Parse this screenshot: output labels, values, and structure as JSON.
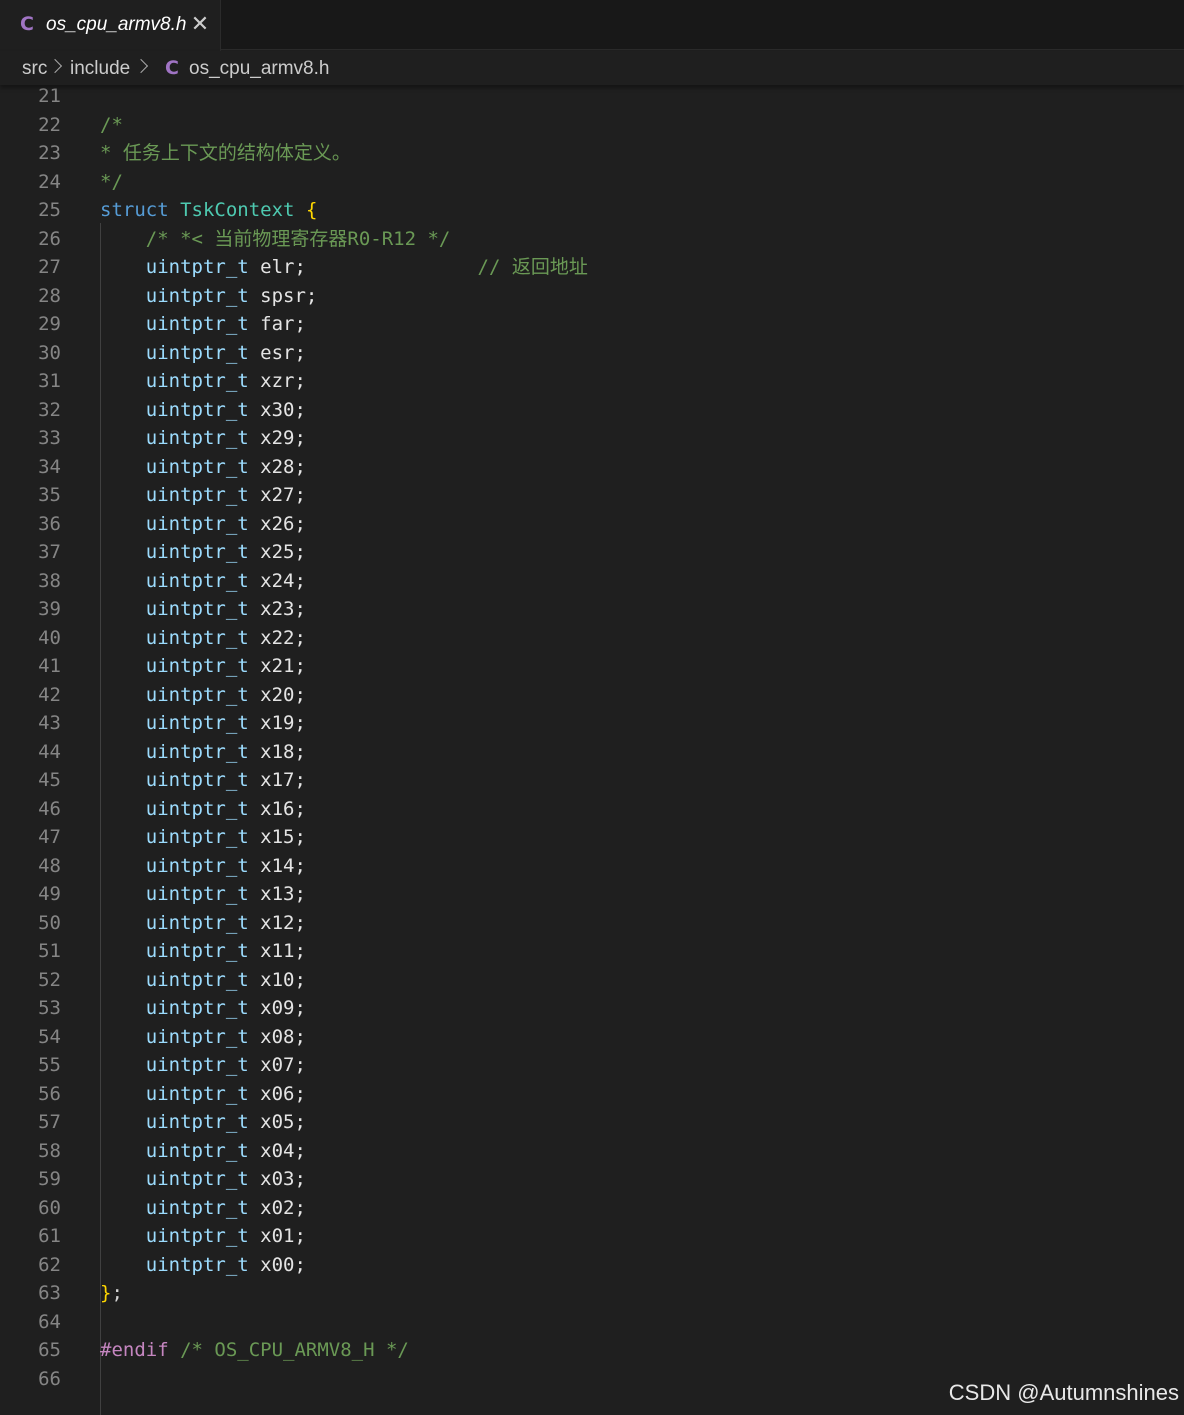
{
  "tab": {
    "file_name": "os_cpu_armv8.h",
    "close_symbol": "✕",
    "language_symbol": "C"
  },
  "breadcrumb": {
    "items": [
      "src",
      "include",
      "os_cpu_armv8.h"
    ]
  },
  "colors": {
    "background": "#1f1f1f",
    "comment": "#6a9955",
    "keyword": "#569cd6",
    "type": "#4ec9b0",
    "field_type": "#9cdcfe",
    "brace": "#ffd700",
    "preprocessor": "#c586c0"
  },
  "code_lines": [
    {
      "n": "21",
      "tokens": []
    },
    {
      "n": "22",
      "tokens": [
        [
          "com",
          "/*"
        ]
      ]
    },
    {
      "n": "23",
      "tokens": [
        [
          "com",
          "* 任务上下文的结构体定义。"
        ]
      ]
    },
    {
      "n": "24",
      "tokens": [
        [
          "com",
          "*/"
        ]
      ]
    },
    {
      "n": "25",
      "tokens": [
        [
          "kw",
          "struct"
        ],
        [
          "plain",
          " "
        ],
        [
          "type",
          "TskContext"
        ],
        [
          "plain",
          " "
        ],
        [
          "brace",
          "{"
        ]
      ]
    },
    {
      "n": "26",
      "tokens": [
        [
          "plain",
          "    "
        ],
        [
          "com",
          "/* *< 当前物理寄存器R0-R12 */"
        ]
      ]
    },
    {
      "n": "27",
      "tokens": [
        [
          "plain",
          "    "
        ],
        [
          "var",
          "uintptr_t"
        ],
        [
          "fld",
          " elr;"
        ],
        [
          "plain",
          "               "
        ],
        [
          "com",
          "// 返回地址"
        ]
      ]
    },
    {
      "n": "28",
      "tokens": [
        [
          "plain",
          "    "
        ],
        [
          "var",
          "uintptr_t"
        ],
        [
          "fld",
          " spsr;"
        ]
      ]
    },
    {
      "n": "29",
      "tokens": [
        [
          "plain",
          "    "
        ],
        [
          "var",
          "uintptr_t"
        ],
        [
          "fld",
          " far;"
        ]
      ]
    },
    {
      "n": "30",
      "tokens": [
        [
          "plain",
          "    "
        ],
        [
          "var",
          "uintptr_t"
        ],
        [
          "fld",
          " esr;"
        ]
      ]
    },
    {
      "n": "31",
      "tokens": [
        [
          "plain",
          "    "
        ],
        [
          "var",
          "uintptr_t"
        ],
        [
          "fld",
          " xzr;"
        ]
      ]
    },
    {
      "n": "32",
      "tokens": [
        [
          "plain",
          "    "
        ],
        [
          "var",
          "uintptr_t"
        ],
        [
          "fld",
          " x30;"
        ]
      ]
    },
    {
      "n": "33",
      "tokens": [
        [
          "plain",
          "    "
        ],
        [
          "var",
          "uintptr_t"
        ],
        [
          "fld",
          " x29;"
        ]
      ]
    },
    {
      "n": "34",
      "tokens": [
        [
          "plain",
          "    "
        ],
        [
          "var",
          "uintptr_t"
        ],
        [
          "fld",
          " x28;"
        ]
      ]
    },
    {
      "n": "35",
      "tokens": [
        [
          "plain",
          "    "
        ],
        [
          "var",
          "uintptr_t"
        ],
        [
          "fld",
          " x27;"
        ]
      ]
    },
    {
      "n": "36",
      "tokens": [
        [
          "plain",
          "    "
        ],
        [
          "var",
          "uintptr_t"
        ],
        [
          "fld",
          " x26;"
        ]
      ]
    },
    {
      "n": "37",
      "tokens": [
        [
          "plain",
          "    "
        ],
        [
          "var",
          "uintptr_t"
        ],
        [
          "fld",
          " x25;"
        ]
      ]
    },
    {
      "n": "38",
      "tokens": [
        [
          "plain",
          "    "
        ],
        [
          "var",
          "uintptr_t"
        ],
        [
          "fld",
          " x24;"
        ]
      ]
    },
    {
      "n": "39",
      "tokens": [
        [
          "plain",
          "    "
        ],
        [
          "var",
          "uintptr_t"
        ],
        [
          "fld",
          " x23;"
        ]
      ]
    },
    {
      "n": "40",
      "tokens": [
        [
          "plain",
          "    "
        ],
        [
          "var",
          "uintptr_t"
        ],
        [
          "fld",
          " x22;"
        ]
      ]
    },
    {
      "n": "41",
      "tokens": [
        [
          "plain",
          "    "
        ],
        [
          "var",
          "uintptr_t"
        ],
        [
          "fld",
          " x21;"
        ]
      ]
    },
    {
      "n": "42",
      "tokens": [
        [
          "plain",
          "    "
        ],
        [
          "var",
          "uintptr_t"
        ],
        [
          "fld",
          " x20;"
        ]
      ]
    },
    {
      "n": "43",
      "tokens": [
        [
          "plain",
          "    "
        ],
        [
          "var",
          "uintptr_t"
        ],
        [
          "fld",
          " x19;"
        ]
      ]
    },
    {
      "n": "44",
      "tokens": [
        [
          "plain",
          "    "
        ],
        [
          "var",
          "uintptr_t"
        ],
        [
          "fld",
          " x18;"
        ]
      ]
    },
    {
      "n": "45",
      "tokens": [
        [
          "plain",
          "    "
        ],
        [
          "var",
          "uintptr_t"
        ],
        [
          "fld",
          " x17;"
        ]
      ]
    },
    {
      "n": "46",
      "tokens": [
        [
          "plain",
          "    "
        ],
        [
          "var",
          "uintptr_t"
        ],
        [
          "fld",
          " x16;"
        ]
      ]
    },
    {
      "n": "47",
      "tokens": [
        [
          "plain",
          "    "
        ],
        [
          "var",
          "uintptr_t"
        ],
        [
          "fld",
          " x15;"
        ]
      ]
    },
    {
      "n": "48",
      "tokens": [
        [
          "plain",
          "    "
        ],
        [
          "var",
          "uintptr_t"
        ],
        [
          "fld",
          " x14;"
        ]
      ]
    },
    {
      "n": "49",
      "tokens": [
        [
          "plain",
          "    "
        ],
        [
          "var",
          "uintptr_t"
        ],
        [
          "fld",
          " x13;"
        ]
      ]
    },
    {
      "n": "50",
      "tokens": [
        [
          "plain",
          "    "
        ],
        [
          "var",
          "uintptr_t"
        ],
        [
          "fld",
          " x12;"
        ]
      ]
    },
    {
      "n": "51",
      "tokens": [
        [
          "plain",
          "    "
        ],
        [
          "var",
          "uintptr_t"
        ],
        [
          "fld",
          " x11;"
        ]
      ]
    },
    {
      "n": "52",
      "tokens": [
        [
          "plain",
          "    "
        ],
        [
          "var",
          "uintptr_t"
        ],
        [
          "fld",
          " x10;"
        ]
      ]
    },
    {
      "n": "53",
      "tokens": [
        [
          "plain",
          "    "
        ],
        [
          "var",
          "uintptr_t"
        ],
        [
          "fld",
          " x09;"
        ]
      ]
    },
    {
      "n": "54",
      "tokens": [
        [
          "plain",
          "    "
        ],
        [
          "var",
          "uintptr_t"
        ],
        [
          "fld",
          " x08;"
        ]
      ]
    },
    {
      "n": "55",
      "tokens": [
        [
          "plain",
          "    "
        ],
        [
          "var",
          "uintptr_t"
        ],
        [
          "fld",
          " x07;"
        ]
      ]
    },
    {
      "n": "56",
      "tokens": [
        [
          "plain",
          "    "
        ],
        [
          "var",
          "uintptr_t"
        ],
        [
          "fld",
          " x06;"
        ]
      ]
    },
    {
      "n": "57",
      "tokens": [
        [
          "plain",
          "    "
        ],
        [
          "var",
          "uintptr_t"
        ],
        [
          "fld",
          " x05;"
        ]
      ]
    },
    {
      "n": "58",
      "tokens": [
        [
          "plain",
          "    "
        ],
        [
          "var",
          "uintptr_t"
        ],
        [
          "fld",
          " x04;"
        ]
      ]
    },
    {
      "n": "59",
      "tokens": [
        [
          "plain",
          "    "
        ],
        [
          "var",
          "uintptr_t"
        ],
        [
          "fld",
          " x03;"
        ]
      ]
    },
    {
      "n": "60",
      "tokens": [
        [
          "plain",
          "    "
        ],
        [
          "var",
          "uintptr_t"
        ],
        [
          "fld",
          " x02;"
        ]
      ]
    },
    {
      "n": "61",
      "tokens": [
        [
          "plain",
          "    "
        ],
        [
          "var",
          "uintptr_t"
        ],
        [
          "fld",
          " x01;"
        ]
      ]
    },
    {
      "n": "62",
      "tokens": [
        [
          "plain",
          "    "
        ],
        [
          "var",
          "uintptr_t"
        ],
        [
          "fld",
          " x00;"
        ]
      ]
    },
    {
      "n": "63",
      "tokens": [
        [
          "brace",
          "}"
        ],
        [
          "plain",
          ";"
        ]
      ]
    },
    {
      "n": "64",
      "tokens": []
    },
    {
      "n": "65",
      "tokens": [
        [
          "pre",
          "#endif"
        ],
        [
          "plain",
          " "
        ],
        [
          "com",
          "/* OS_CPU_ARMV8_H */"
        ]
      ]
    },
    {
      "n": "66",
      "tokens": []
    }
  ],
  "watermark": "CSDN @Autumnshines"
}
